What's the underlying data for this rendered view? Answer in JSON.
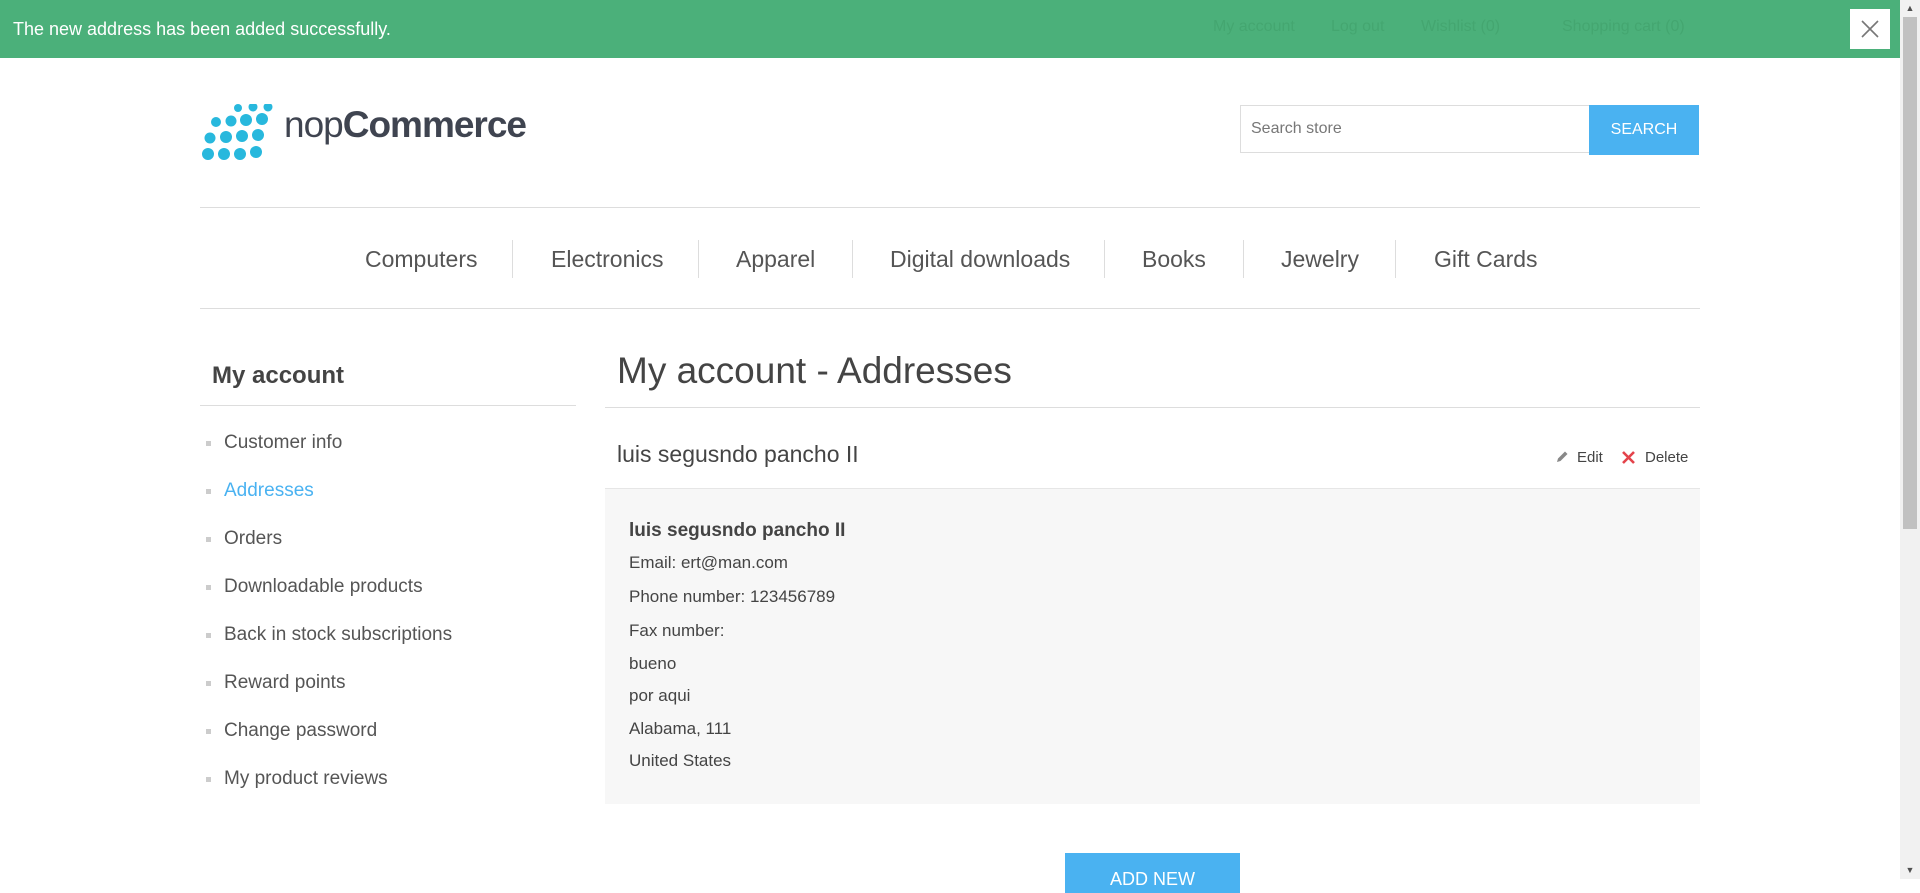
{
  "notification": {
    "message": "The new address has been added successfully.",
    "close_icon": "close-icon"
  },
  "header_links": [
    "My account",
    "Log out",
    "Wishlist (0)",
    "Shopping cart (0)"
  ],
  "logo": {
    "prefix": "nop",
    "suffix": "Commerce"
  },
  "search": {
    "placeholder": "Search store",
    "button_label": "SEARCH"
  },
  "menu": [
    "Computers",
    "Electronics",
    "Apparel",
    "Digital downloads",
    "Books",
    "Jewelry",
    "Gift Cards"
  ],
  "sidebar": {
    "title": "My account",
    "items": [
      "Customer info",
      "Addresses",
      "Orders",
      "Downloadable products",
      "Back in stock subscriptions",
      "Reward points",
      "Change password",
      "My product reviews"
    ],
    "active_index": 1
  },
  "main": {
    "title": "My account - Addresses",
    "address": {
      "heading": "luis segusndo pancho II",
      "edit_label": "Edit",
      "delete_label": "Delete",
      "name": "luis segusndo pancho II",
      "email": "Email: ert@man.com",
      "phone": "Phone number: 123456789",
      "fax": "Fax number:",
      "address1": "bueno",
      "address2": "por aqui",
      "city_state_zip": "Alabama, 111",
      "country": "United States"
    },
    "add_new_label": "ADD NEW"
  },
  "colors": {
    "notification_bg": "#4bb07a",
    "accent": "#4ab2f1",
    "delete_icon": "#e4434b"
  }
}
